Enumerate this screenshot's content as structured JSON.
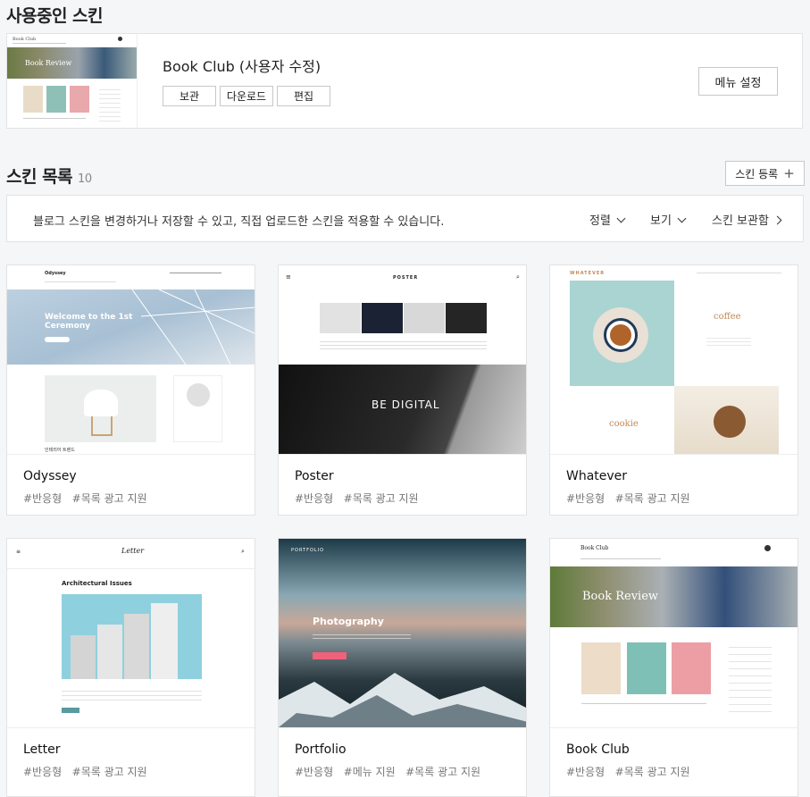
{
  "current": {
    "section_title": "사용중인 스킨",
    "skin_name": "Book Club (사용자 수정)",
    "buttons": {
      "keep": "보관",
      "download": "다운로드",
      "edit": "편집"
    },
    "menu_settings": "메뉴 설정",
    "thumb_title": "Book Club",
    "thumb_banner": "Book Review"
  },
  "list": {
    "section_title": "스킨 목록",
    "count": "10",
    "register_label": "스킨 등록",
    "info_text": "블로그 스킨을 변경하거나 저장할 수 있고, 직접 업로드한 스킨을 적용할 수 있습니다.",
    "sort_label": "정렬",
    "view_label": "보기",
    "storage_label": "스킨 보관함"
  },
  "skins": [
    {
      "name": "Odyssey",
      "tags": [
        "#반응형",
        "#목록 광고 지원"
      ],
      "thumb": {
        "logo": "Odyssey",
        "headline": "Welcome to the 1st Ceremony",
        "caption": "인테리어 트렌드"
      }
    },
    {
      "name": "Poster",
      "tags": [
        "#반응형",
        "#목록 광고 지원"
      ],
      "thumb": {
        "logo": "POSTER",
        "banner": "BE DIGITAL"
      }
    },
    {
      "name": "Whatever",
      "tags": [
        "#반응형",
        "#목록 광고 지원"
      ],
      "thumb": {
        "logo": "WHATEVER",
        "word1": "coffee",
        "word2": "cookie"
      }
    },
    {
      "name": "Letter",
      "tags": [
        "#반응형",
        "#목록 광고 지원"
      ],
      "thumb": {
        "logo": "Letter",
        "headline": "Architectural Issues"
      }
    },
    {
      "name": "Portfolio",
      "tags": [
        "#반응형",
        "#메뉴 지원",
        "#목록 광고 지원"
      ],
      "thumb": {
        "logo": "PORTFOLIO",
        "headline": "Photography"
      }
    },
    {
      "name": "Book Club",
      "tags": [
        "#반응형",
        "#목록 광고 지원"
      ],
      "thumb": {
        "logo": "Book Club",
        "banner": "Book Review"
      }
    }
  ],
  "colors": {
    "accent_pink": "#f0617a",
    "teal": "#5a9aa0",
    "dark": "#2a2a2a"
  }
}
